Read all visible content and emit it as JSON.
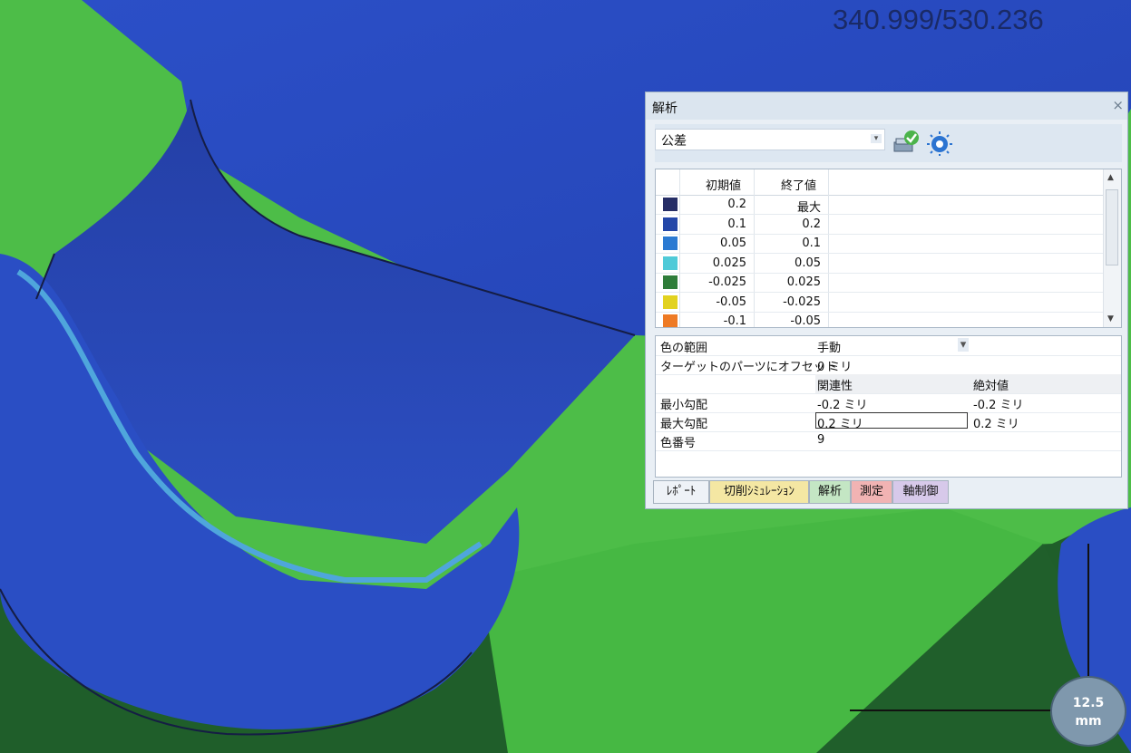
{
  "viewport": {
    "coordinate_readout": "340.999/530.236",
    "scale_value": "12.5",
    "scale_unit": "mm",
    "colors": {
      "green_surface": "#4dbd48",
      "dark_green": "#1f5e2a",
      "blue_part": "#2a4fc4",
      "cyan": "#4fa6dc"
    }
  },
  "panel": {
    "title": "解析",
    "close_glyph": "×",
    "analysis_type": "公差",
    "icons": {
      "apply": "check-stack-icon",
      "settings": "dial-gauge-icon"
    },
    "table": {
      "col_start": "初期値",
      "col_end": "終了値",
      "rows": [
        {
          "color": "#262e66",
          "start": "0.2",
          "end": "最大"
        },
        {
          "color": "#2447a8",
          "start": "0.1",
          "end": "0.2"
        },
        {
          "color": "#2b7ad2",
          "start": "0.05",
          "end": "0.1"
        },
        {
          "color": "#4fcad8",
          "start": "0.025",
          "end": "0.05"
        },
        {
          "color": "#2f7d3a",
          "start": "-0.025",
          "end": "0.025"
        },
        {
          "color": "#e2d21f",
          "start": "-0.05",
          "end": "-0.025"
        },
        {
          "color": "#ee7a24",
          "start": "-0.1",
          "end": "-0.05"
        }
      ]
    },
    "props": {
      "color_range_label": "色の範囲",
      "color_range_value": "手動",
      "offset_label": "ターゲットのパーツにオフセット",
      "offset_value": "0 ミリ",
      "rel_header": "関連性",
      "abs_header": "絶対値",
      "min_label": "最小勾配",
      "min_rel": "-0.2 ミリ",
      "min_abs": "-0.2 ミリ",
      "max_label": "最大勾配",
      "max_rel": "0.2 ミリ",
      "max_abs": "0.2 ミリ",
      "count_label": "色番号",
      "count_value": "9"
    },
    "tabs": [
      {
        "label": "ﾚﾎﾟｰﾄ",
        "color": "#eef2f7"
      },
      {
        "label": "切削ｼﾐｭﾚｰｼｮﾝ",
        "color": "#f4e7a3"
      },
      {
        "label": "解析",
        "color": "#c4e6c4"
      },
      {
        "label": "測定",
        "color": "#f1b3b3"
      },
      {
        "label": "軸制御",
        "color": "#d7c9ea"
      }
    ]
  }
}
